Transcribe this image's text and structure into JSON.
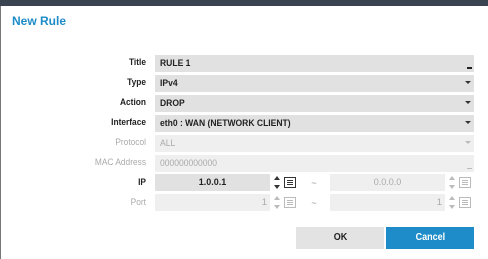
{
  "dialog": {
    "title": "New Rule"
  },
  "form": {
    "title": {
      "label": "Title",
      "value": "RULE 1"
    },
    "type": {
      "label": "Type",
      "value": "IPv4"
    },
    "action": {
      "label": "Action",
      "value": "DROP"
    },
    "interface": {
      "label": "Interface",
      "value": "eth0 : WAN (NETWORK CLIENT)"
    },
    "protocol": {
      "label": "Protocol",
      "value": "ALL"
    },
    "mac": {
      "label": "MAC Address",
      "value": "000000000000"
    },
    "ip": {
      "label": "IP",
      "from": "1.0.0.1",
      "separator": "~",
      "to": "0.0.0.0"
    },
    "port": {
      "label": "Port",
      "from": "1",
      "separator": "~",
      "to": "1"
    }
  },
  "buttons": {
    "ok": "OK",
    "cancel": "Cancel"
  },
  "colors": {
    "accent": "#1e8cc8",
    "topbar": "#3a4450"
  }
}
